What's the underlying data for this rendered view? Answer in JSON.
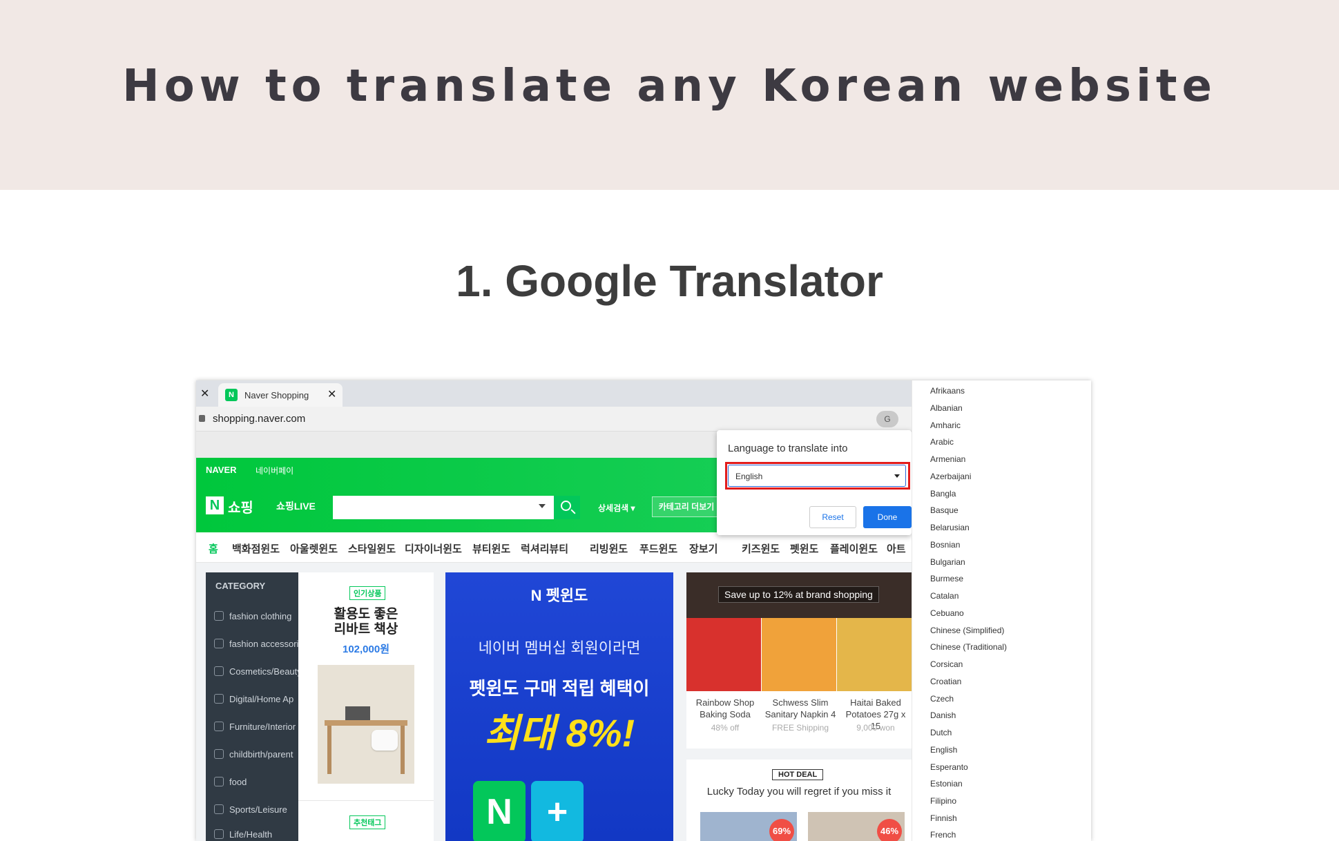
{
  "page": {
    "title": "How to translate any Korean website",
    "section_title": "1. Google Translator"
  },
  "browser": {
    "tab_label": "Naver Shopping",
    "favicon_letter": "N",
    "url": "shopping.naver.com",
    "translate_icon": "G",
    "close_symbol": "✕"
  },
  "naver": {
    "logo": "NAVER",
    "pay": "네이버페이",
    "n_logo": "N",
    "shopping": "쇼핑",
    "shopping_live": "쇼핑LIVE",
    "detail_search": "상세검색 ▾",
    "more_categories": "카테고리 더보기",
    "catnav": [
      "홈",
      "백화점윈도",
      "아울렛윈도",
      "스타일윈도",
      "디자이너윈도",
      "뷰티윈도",
      "럭셔리뷰티",
      "리빙윈도",
      "푸드윈도",
      "장보기",
      "키즈윈도",
      "펫윈도",
      "플레이윈도",
      "아트"
    ],
    "sidebar": {
      "heading": "CATEGORY",
      "items": [
        "fashion clothing",
        "fashion accessories",
        "Cosmetics/Beauty",
        "Digital/Home Ap",
        "Furniture/Interior",
        "childbirth/parent",
        "food",
        "Sports/Leisure",
        "Life/Health"
      ]
    },
    "promo": {
      "badge": "인기상품",
      "title_line1": "활용도 좋은",
      "title_line2": "리바트 책상",
      "price": "102,000원",
      "recommended": "추천태그"
    },
    "banner": {
      "logo": "N 펫윈도",
      "subtitle": "네이버 멤버십 회원이라면",
      "line2": "펫윈도 구매 적립 혜택이",
      "big": "최대 8%!",
      "n_tile": "N",
      "plus_tile": "+"
    },
    "brand": {
      "caption": "Save up to 12% at brand shopping",
      "products": [
        {
          "name": "Rainbow Shop Baking Soda",
          "meta": "48% off"
        },
        {
          "name": "Schwess Slim Sanitary Napkin 4",
          "meta": "FREE Shipping"
        },
        {
          "name": "Haitai Baked Potatoes 27g x 15",
          "meta": "9,000 won"
        }
      ]
    },
    "hotdeal": {
      "badge": "HOT DEAL",
      "text": "Lucky Today you will regret if you miss it",
      "discounts": [
        "69%",
        "46%"
      ]
    }
  },
  "translate_popup": {
    "label": "Language to translate into",
    "selected_language": "English",
    "reset": "Reset",
    "done": "Done"
  },
  "languages": [
    "Afrikaans",
    "Albanian",
    "Amharic",
    "Arabic",
    "Armenian",
    "Azerbaijani",
    "Bangla",
    "Basque",
    "Belarusian",
    "Bosnian",
    "Bulgarian",
    "Burmese",
    "Catalan",
    "Cebuano",
    "Chinese (Simplified)",
    "Chinese (Traditional)",
    "Corsican",
    "Croatian",
    "Czech",
    "Danish",
    "Dutch",
    "English",
    "Esperanto",
    "Estonian",
    "Filipino",
    "Finnish",
    "French"
  ],
  "colors": {
    "header_band": "#f1e8e5",
    "naver_green": "#03c75a",
    "highlight_red": "#e21b1b",
    "done_blue": "#1a73e8"
  }
}
